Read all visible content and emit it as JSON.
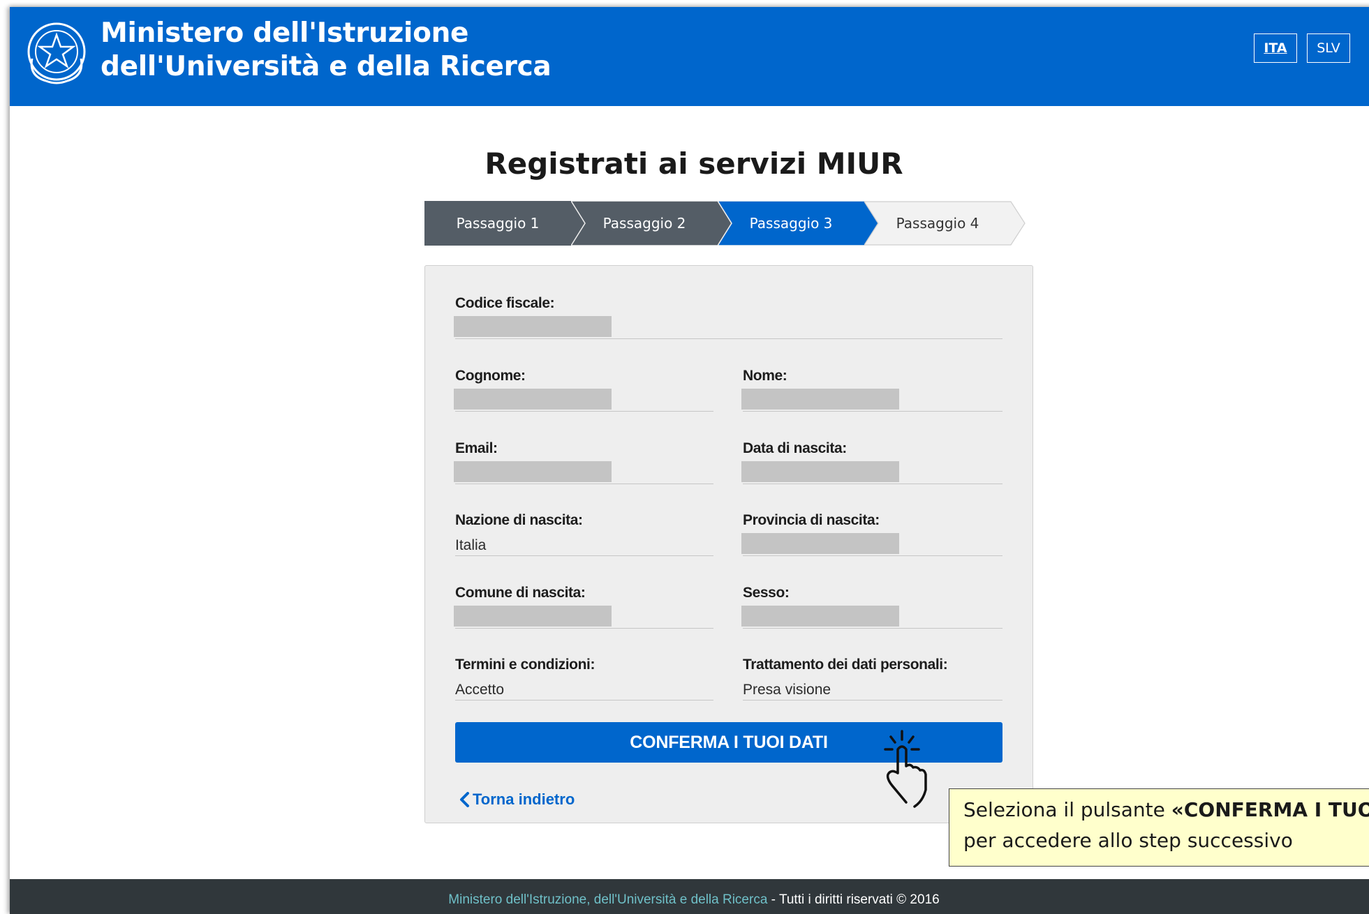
{
  "header": {
    "title_line1": "Ministero dell'Istruzione",
    "title_line2": "dell'Università e della Ricerca",
    "emblem_icon": "italian-republic-emblem-icon",
    "languages": [
      {
        "label": "ITA",
        "active": true
      },
      {
        "label": "SLV",
        "active": false
      }
    ],
    "background_color": "#0066cc"
  },
  "page_title": "Registrati ai servizi MIUR",
  "stepper": {
    "steps": [
      {
        "label": "Passaggio 1",
        "state": "done"
      },
      {
        "label": "Passaggio 2",
        "state": "done"
      },
      {
        "label": "Passaggio 3",
        "state": "current"
      },
      {
        "label": "Passaggio 4",
        "state": "upcoming"
      }
    ],
    "colors": {
      "done": "#545d66",
      "current": "#0066cc",
      "upcoming": "#f2f2f2"
    }
  },
  "form": {
    "fields": {
      "codice_fiscale": {
        "label": "Codice fiscale:"
      },
      "cognome": {
        "label": "Cognome:"
      },
      "nome": {
        "label": "Nome:"
      },
      "email": {
        "label": "Email:"
      },
      "data_nascita": {
        "label": "Data di nascita:"
      },
      "nazione_nascita": {
        "label": "Nazione di nascita:",
        "value": "Italia"
      },
      "provincia_nascita": {
        "label": "Provincia di nascita:"
      },
      "comune_nascita": {
        "label": "Comune di nascita:"
      },
      "sesso": {
        "label": "Sesso:"
      },
      "termini": {
        "label": "Termini e condizioni:",
        "value": "Accetto"
      },
      "trattamento": {
        "label": "Trattamento dei dati personali:",
        "value": "Presa visione"
      }
    },
    "confirm_label": "CONFERMA I TUOI DATI",
    "back_label": "Torna indietro"
  },
  "callout": {
    "text_before": "Seleziona il pulsante ",
    "text_bold": "«CONFERMA I TUOI DATI»",
    "text_line2": "per accedere allo step successivo",
    "pointer_icon": "hand-pointer-icon"
  },
  "footer": {
    "ministry_link": "Ministero dell'Istruzione, dell'Università e della Ricerca",
    "rights": " - Tutti i diritti riservati © 2016"
  }
}
